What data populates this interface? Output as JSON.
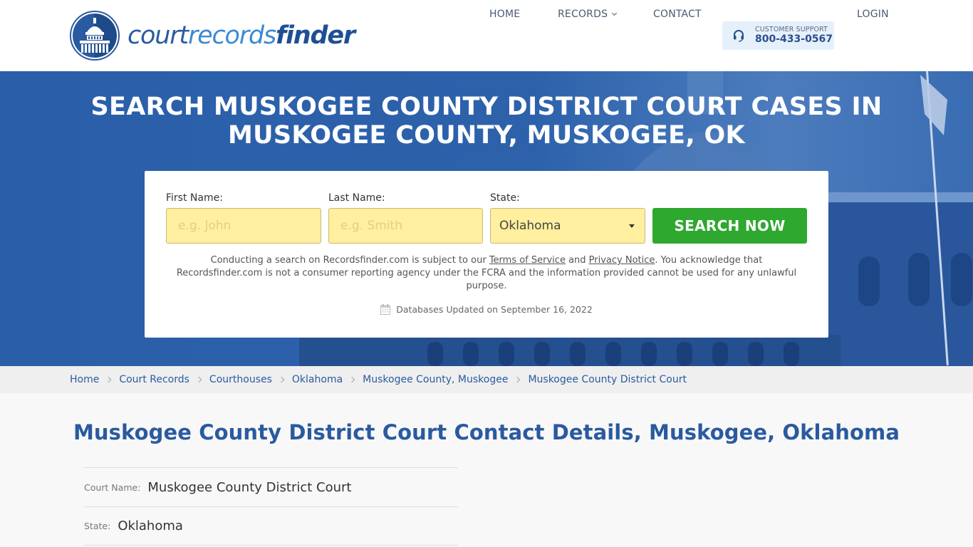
{
  "brand": {
    "part1": "court",
    "part2": "records",
    "part3": "finder",
    "accent": "#2a5aa0"
  },
  "nav": {
    "home": "HOME",
    "records": "RECORDS",
    "contact": "CONTACT",
    "login": "LOGIN",
    "support_label": "CUSTOMER SUPPORT",
    "support_phone": "800-433-0567"
  },
  "hero": {
    "title_line1": "SEARCH MUSKOGEE COUNTY DISTRICT COURT CASES IN",
    "title_line2": "MUSKOGEE COUNTY, MUSKOGEE, OK"
  },
  "search": {
    "first_label": "First Name:",
    "first_placeholder": "e.g. John",
    "last_label": "Last Name:",
    "last_placeholder": "e.g. Smith",
    "state_label": "State:",
    "state_value": "Oklahoma",
    "button_label": "SEARCH NOW",
    "button_color": "#2ea82e",
    "field_color": "#ffef9e"
  },
  "disclaimer": {
    "part1": "Conducting a search on Recordsfinder.com is subject to our ",
    "tos": "Terms of Service",
    "and": " and ",
    "privacy": "Privacy Notice",
    "part2": ". You acknowledge that Recordsfinder.com is not a consumer reporting agency under the FCRA and the information provided cannot be used for any unlawful purpose."
  },
  "db_updated": "Databases Updated on September 16, 2022",
  "breadcrumb": [
    "Home",
    "Court Records",
    "Courthouses",
    "Oklahoma",
    "Muskogee County, Muskogee",
    "Muskogee County District Court"
  ],
  "main": {
    "title": "Muskogee County District Court Contact Details, Muskogee, Oklahoma",
    "details": [
      {
        "key": "Court Name:",
        "value": "Muskogee County District Court"
      },
      {
        "key": "State:",
        "value": "Oklahoma"
      }
    ]
  }
}
